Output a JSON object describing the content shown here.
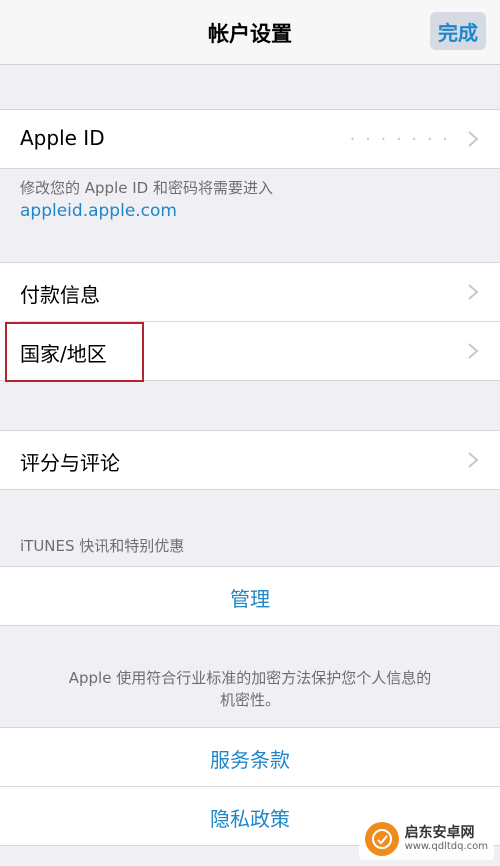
{
  "nav": {
    "title": "帐户设置",
    "done_label": "完成"
  },
  "apple_id": {
    "label": "Apple ID",
    "value": "·  ·  ·  ·  ·  ·  ·",
    "footer_line1": "修改您的 Apple ID 和密码将需要进入",
    "footer_link": "appleid.apple.com"
  },
  "payment": {
    "label": "付款信息"
  },
  "country": {
    "label": "国家/地区"
  },
  "ratings": {
    "label": "评分与评论"
  },
  "itunes": {
    "section_header": "iTUNES 快讯和特别优惠",
    "manage_label": "管理"
  },
  "privacy_note": {
    "line1": "Apple 使用符合行业标准的加密方法保护您个人信息的",
    "line2": "机密性。"
  },
  "terms": {
    "label": "服务条款"
  },
  "privacy_policy": {
    "label": "隐私政策"
  },
  "watermark": {
    "title": "启东安卓网",
    "url": "www.qdltdq.com"
  },
  "colors": {
    "accent": "#1f86c9",
    "highlight": "#b3252d",
    "background": "#efeff4"
  }
}
